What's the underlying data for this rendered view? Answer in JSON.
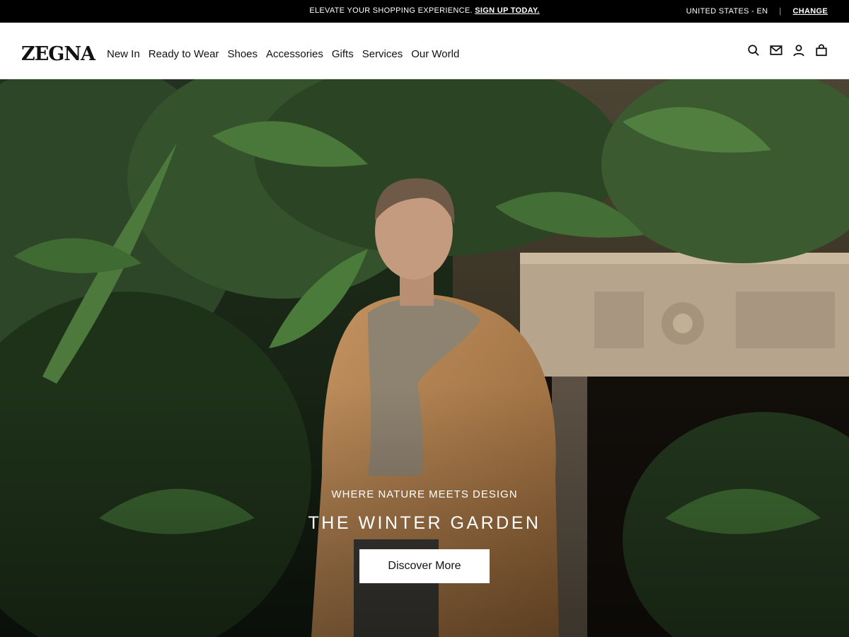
{
  "promo": {
    "message": "ELEVATE YOUR SHOPPING EXPERIENCE.",
    "link_label": "SIGN UP TODAY.",
    "locale": "UNITED STATES - EN",
    "divider": "|",
    "change_label": "CHANGE"
  },
  "header": {
    "logo": "ZEGNA",
    "nav": [
      "New In",
      "Ready to Wear",
      "Shoes",
      "Accessories",
      "Gifts",
      "Services",
      "Our World"
    ],
    "icons": [
      "search-icon",
      "mail-icon",
      "account-icon",
      "bag-icon"
    ]
  },
  "hero": {
    "eyebrow": "WHERE NATURE MEETS DESIGN",
    "headline": "THE WINTER GARDEN",
    "cta_label": "Discover More"
  },
  "colors": {
    "promo_bg": "#000000",
    "header_bg": "#ffffff",
    "text": "#111111",
    "cta_bg": "#ffffff",
    "foliage": "#2f4a28",
    "coat": "#b5834f",
    "sweater": "#8e8270",
    "marble": "#b6a48c"
  }
}
